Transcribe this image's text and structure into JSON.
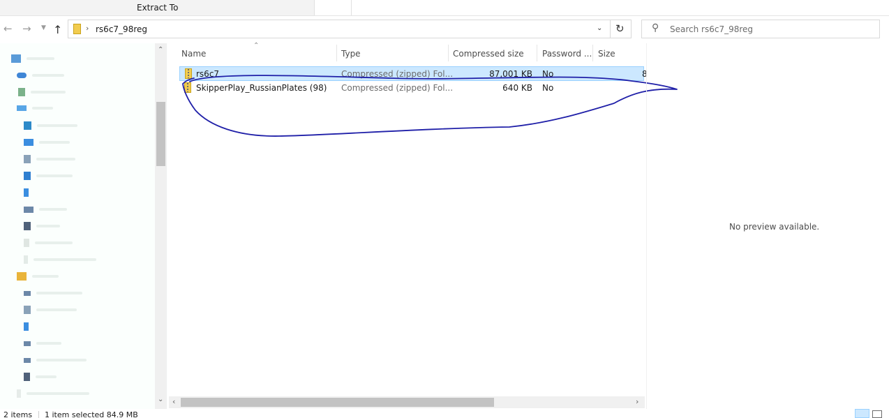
{
  "ribbon": {
    "context_tab": "Extract To"
  },
  "address": {
    "path": "rs6c7_98reg"
  },
  "search": {
    "placeholder": "Search rs6c7_98reg"
  },
  "columns": [
    "Name",
    "Type",
    "Compressed size",
    "Password ...",
    "Size"
  ],
  "files": [
    {
      "name": "rs6c7",
      "type": "Compressed (zipped) Fol...",
      "compressed_size": "87,001 KB",
      "password": "No",
      "size": "8",
      "selected": true
    },
    {
      "name": "SkipperPlay_RussianPlates (98)",
      "type": "Compressed (zipped) Fol...",
      "compressed_size": "640 KB",
      "password": "No",
      "size": "",
      "selected": false
    }
  ],
  "preview": {
    "message": "No preview available."
  },
  "status": {
    "items_count": "2 items",
    "selection": "1 item selected  84.9 MB"
  },
  "colors": {
    "selection_bg": "#cce8ff",
    "selection_border": "#99d1ff",
    "annotation": "#1f1fa8",
    "accent": "#0078d7"
  }
}
